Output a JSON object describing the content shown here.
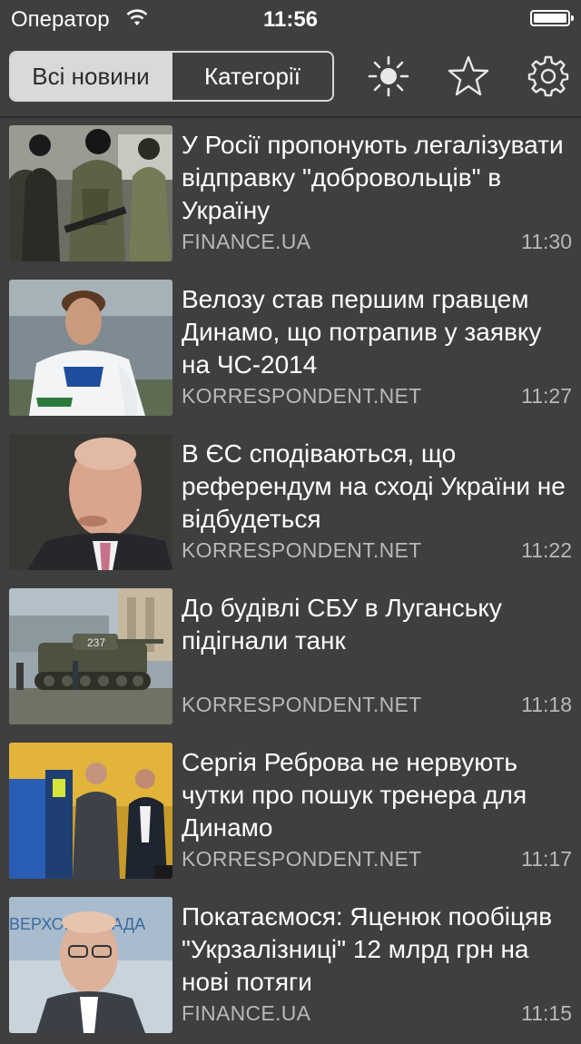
{
  "status": {
    "carrier": "Оператор",
    "time": "11:56"
  },
  "toolbar": {
    "tabs": [
      {
        "label": "Всі новини",
        "active": true
      },
      {
        "label": "Категорії",
        "active": false
      }
    ],
    "icons": [
      "brightness-icon",
      "star-icon",
      "gear-icon"
    ]
  },
  "news": [
    {
      "title": "У Росії пропонують легалізувати відправку \"добровольців\" в Україну",
      "source": "FINANCE.UA",
      "time": "11:30"
    },
    {
      "title": "Велозу став першим гравцем Динамо, що потрапив у заявку на ЧС-2014",
      "source": "KORRESPONDENT.NET",
      "time": "11:27"
    },
    {
      "title": "В ЄС сподіваються, що референдум на сході України не відбудеться",
      "source": "KORRESPONDENT.NET",
      "time": "11:22"
    },
    {
      "title": "До будівлі СБУ в Луганську підігнали танк",
      "source": "KORRESPONDENT.NET",
      "time": "11:18"
    },
    {
      "title": "Сергія Реброва не нервують чутки про пошук тренера для Динамо",
      "source": "KORRESPONDENT.NET",
      "time": "11:17"
    },
    {
      "title": "Покатаємося: Яценюк пообіцяв \"Укрзалізниці\" 12 млрд грн на нові потяги",
      "source": "FINANCE.UA",
      "time": "11:15"
    }
  ],
  "thumb_labels": {
    "tank_number": "237",
    "parliament_text": "ВЕРХОВНА РАДА"
  },
  "colors": {
    "background": "#3f3f3f",
    "segment_active": "#d9d9d9",
    "source_text": "#b8b8b8"
  }
}
